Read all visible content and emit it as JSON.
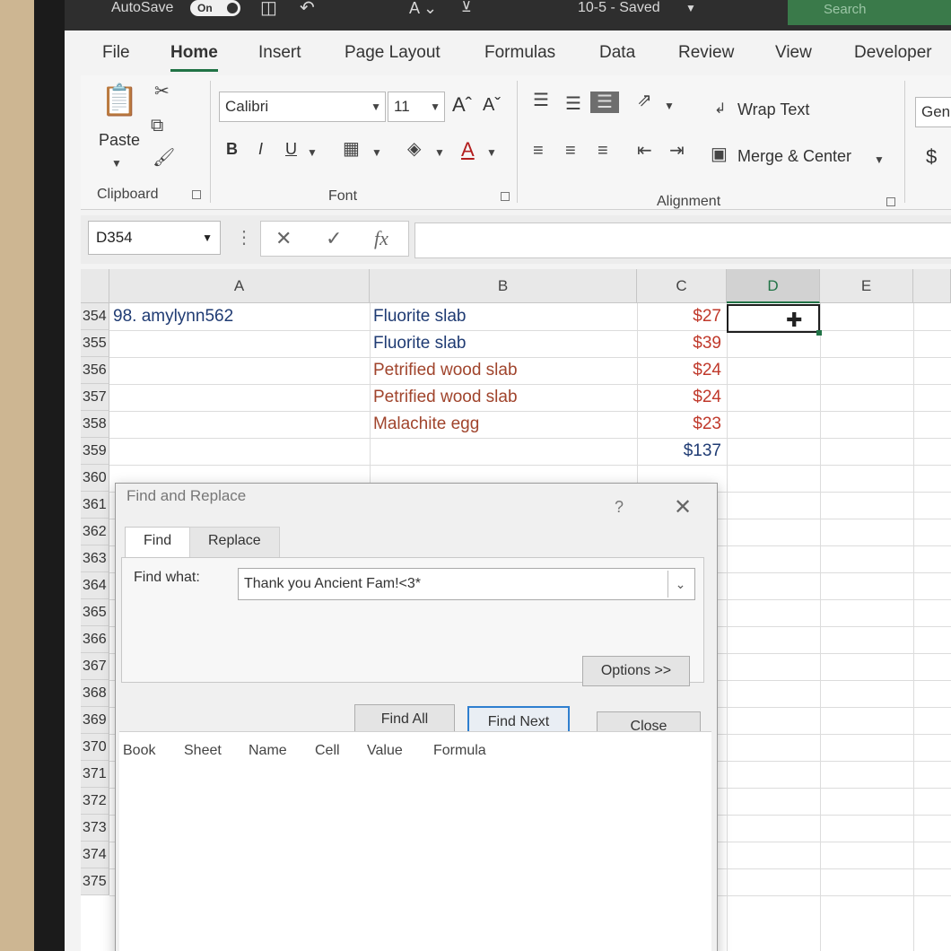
{
  "titlebar": {
    "autosave_label": "AutoSave",
    "autosave_state": "On",
    "filename": "10-5 - Saved",
    "search": "Search"
  },
  "ribbon_tabs": [
    "File",
    "Home",
    "Insert",
    "Page Layout",
    "Formulas",
    "Data",
    "Review",
    "View",
    "Developer"
  ],
  "clipboard": {
    "paste": "Paste",
    "label": "Clipboard"
  },
  "font": {
    "name": "Calibri",
    "size": "11",
    "bold": "B",
    "italic": "I",
    "underline": "U",
    "grow": "Aˆ",
    "shrink": "Aˇ",
    "color_a": "A",
    "label": "Font"
  },
  "alignment": {
    "wrap": "Wrap Text",
    "merge": "Merge & Center",
    "label": "Alignment"
  },
  "number": {
    "format": "Gen",
    "currency": "$"
  },
  "formula_bar": {
    "name_box": "D354",
    "cancel": "✕",
    "enter": "✓",
    "fx": "fx"
  },
  "columns": [
    "A",
    "B",
    "C",
    "D",
    "E"
  ],
  "rows": [
    {
      "num": "354",
      "a": "98. amylynn562",
      "b": "Fluorite slab",
      "c": "$27",
      "b_color": "#1f3b73"
    },
    {
      "num": "355",
      "a": "",
      "b": "Fluorite slab",
      "c": "$39",
      "b_color": "#1f3b73"
    },
    {
      "num": "356",
      "a": "",
      "b": "Petrified wood slab",
      "c": "$24",
      "b_color": "#a0442c"
    },
    {
      "num": "357",
      "a": "",
      "b": "Petrified wood slab",
      "c": "$24",
      "b_color": "#a0442c"
    },
    {
      "num": "358",
      "a": "",
      "b": "Malachite egg",
      "c": "$23",
      "b_color": "#a0442c"
    },
    {
      "num": "359",
      "a": "",
      "b": "",
      "c": "$137",
      "b_color": "#1f3b73"
    },
    {
      "num": "360",
      "a": "",
      "b": "",
      "c": "",
      "b_color": "#1f3b73"
    },
    {
      "num": "361",
      "a": "",
      "b": "",
      "c": "",
      "b_color": "#1f3b73"
    },
    {
      "num": "362",
      "a": "",
      "b": "",
      "c": "",
      "b_color": "#1f3b73"
    },
    {
      "num": "363",
      "a": "",
      "b": "",
      "c": "",
      "b_color": "#1f3b73"
    },
    {
      "num": "364",
      "a": "",
      "b": "",
      "c": "",
      "b_color": "#1f3b73"
    },
    {
      "num": "365",
      "a": "",
      "b": "",
      "c": "",
      "b_color": "#1f3b73"
    },
    {
      "num": "366",
      "a": "",
      "b": "",
      "c": "",
      "b_color": "#1f3b73"
    },
    {
      "num": "367",
      "a": "",
      "b": "",
      "c": "",
      "b_color": "#1f3b73"
    },
    {
      "num": "368",
      "a": "",
      "b": "",
      "c": "",
      "b_color": "#1f3b73"
    },
    {
      "num": "369",
      "a": "",
      "b": "",
      "c": "",
      "b_color": "#1f3b73"
    },
    {
      "num": "370",
      "a": "",
      "b": "",
      "c": "",
      "b_color": "#1f3b73"
    },
    {
      "num": "371",
      "a": "",
      "b": "",
      "c": "",
      "b_color": "#1f3b73"
    },
    {
      "num": "372",
      "a": "",
      "b": "",
      "c": "",
      "b_color": "#1f3b73"
    },
    {
      "num": "373",
      "a": "",
      "b": "",
      "c": "",
      "b_color": "#1f3b73"
    },
    {
      "num": "374",
      "a": "",
      "b": "",
      "c": "",
      "b_color": "#1f3b73"
    },
    {
      "num": "375",
      "a": "",
      "b": "",
      "c": "",
      "b_color": "#1f3b73"
    }
  ],
  "price_color": "#c0392b",
  "dialog": {
    "title": "Find and Replace",
    "help": "?",
    "close_x": "✕",
    "tabs": [
      "Find",
      "Replace"
    ],
    "find_label": "Find what:",
    "find_value": "Thank you Ancient Fam!<3*",
    "options": "Options >>",
    "find_all": "Find All",
    "find_next": "Find Next",
    "close": "Close",
    "result_columns": [
      "Book",
      "Sheet",
      "Name",
      "Cell",
      "Value",
      "Formula"
    ]
  }
}
